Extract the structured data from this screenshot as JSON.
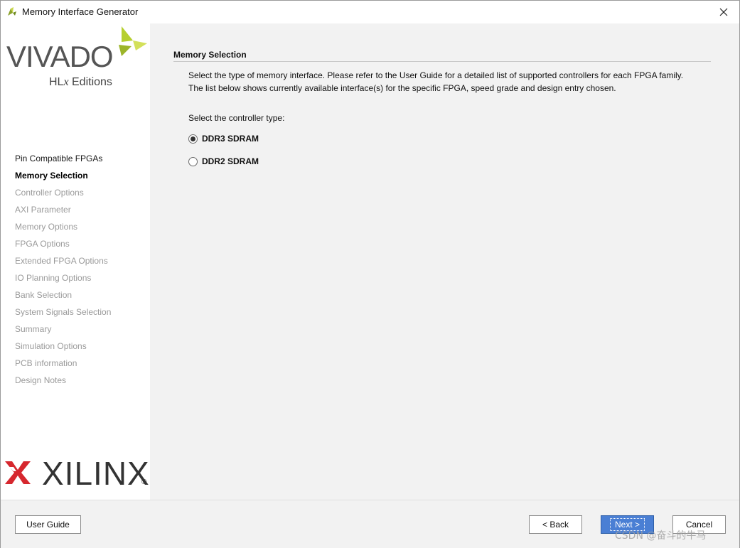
{
  "window": {
    "title": "Memory Interface Generator",
    "accent_color": "#4a7fd4"
  },
  "branding": {
    "product_logo": {
      "word": "VIVADO",
      "edition_prefix": "HL",
      "edition_x": "x",
      "edition_suffix": " Editions"
    },
    "vendor_logo": {
      "word": "XILINX",
      "registered": "®"
    }
  },
  "sidebar": {
    "steps": [
      {
        "label": "Pin Compatible FPGAs",
        "state": "done"
      },
      {
        "label": "Memory Selection",
        "state": "current"
      },
      {
        "label": "Controller Options",
        "state": "pending"
      },
      {
        "label": "AXI Parameter",
        "state": "pending"
      },
      {
        "label": "Memory Options",
        "state": "pending"
      },
      {
        "label": "FPGA Options",
        "state": "pending"
      },
      {
        "label": "Extended FPGA Options",
        "state": "pending"
      },
      {
        "label": "IO Planning Options",
        "state": "pending"
      },
      {
        "label": "Bank Selection",
        "state": "pending"
      },
      {
        "label": "System Signals Selection",
        "state": "pending"
      },
      {
        "label": "Summary",
        "state": "pending"
      },
      {
        "label": "Simulation Options",
        "state": "pending"
      },
      {
        "label": "PCB information",
        "state": "pending"
      },
      {
        "label": "Design Notes",
        "state": "pending"
      }
    ]
  },
  "main": {
    "section_title": "Memory Selection",
    "description_line1": "Select the type of memory interface. Please refer to the User Guide for a detailed list of supported controllers for each FPGA family.",
    "description_line2": "The list below shows currently available interface(s) for the specific FPGA, speed grade and design entry chosen.",
    "controller_label": "Select the controller type:",
    "options": [
      {
        "label": "DDR3 SDRAM",
        "selected": true
      },
      {
        "label": "DDR2 SDRAM",
        "selected": false
      }
    ]
  },
  "footer": {
    "user_guide_label": "User Guide",
    "back_label": "< Back",
    "next_label": "Next >",
    "cancel_label": "Cancel"
  },
  "watermark": "CSDN @奋斗的牛马"
}
